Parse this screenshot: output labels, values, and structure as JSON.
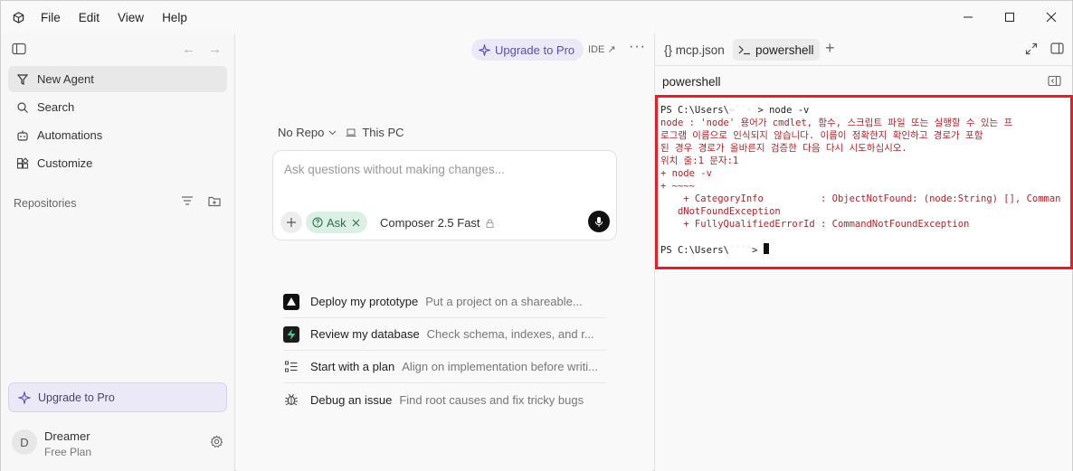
{
  "menu": {
    "file": "File",
    "edit": "Edit",
    "view": "View",
    "help": "Help"
  },
  "sidebar": {
    "items": [
      {
        "label": "New Agent",
        "icon": "agent-icon"
      },
      {
        "label": "Search",
        "icon": "search-icon"
      },
      {
        "label": "Automations",
        "icon": "automations-icon"
      },
      {
        "label": "Customize",
        "icon": "customize-icon"
      }
    ],
    "repositories_label": "Repositories",
    "upgrade_label": "Upgrade to Pro",
    "user": {
      "initial": "D",
      "name": "Dreamer",
      "plan": "Free Plan"
    }
  },
  "main": {
    "upgrade_label": "Upgrade to Pro",
    "ide_label": "IDE ↗",
    "repo_label": "No Repo",
    "location_label": "This PC",
    "composer": {
      "placeholder": "Ask questions without making changes...",
      "mode_label": "Ask",
      "model_label": "Composer 2.5 Fast"
    },
    "suggestions": [
      {
        "title": "Deploy my prototype",
        "desc": "Put a project on a shareable..."
      },
      {
        "title": "Review my database",
        "desc": "Check schema, indexes, and r..."
      },
      {
        "title": "Start with a plan",
        "desc": "Align on implementation before writi..."
      },
      {
        "title": "Debug an issue",
        "desc": "Find root causes and fix tricky bugs"
      }
    ]
  },
  "right_pane": {
    "tabs": [
      {
        "label": "{} mcp.json"
      },
      {
        "label": "powershell"
      }
    ],
    "title": "powershell",
    "terminal": {
      "prompt1": "PS C:\\Users\\",
      "cmd1": "> node -v",
      "error_lines": [
        "node : 'node' 용어가 cmdlet, 함수, 스크립트 파일 또는 실행할 수 있는 프",
        "로그램 이름으로 인식되지 않습니다. 이름이 정확한지 확인하고 경로가 포함",
        "된 경우 경로가 올바른지 검증한 다음 다시 시도하십시오.",
        "위치 줄:1 문자:1",
        "+ node -v",
        "+ ~~~~",
        "    + CategoryInfo          : ObjectNotFound: (node:String) [], Comman",
        "   dNotFoundException",
        "    + FullyQualifiedErrorId : CommandNotFoundException"
      ],
      "prompt2": "PS C:\\Users\\",
      "prompt2_end": ">"
    }
  },
  "colors": {
    "accent_purple": "#5a4fae",
    "ask_green": "#2f6d4a",
    "error_red": "#b4232a",
    "highlight_border": "#e0202a"
  }
}
